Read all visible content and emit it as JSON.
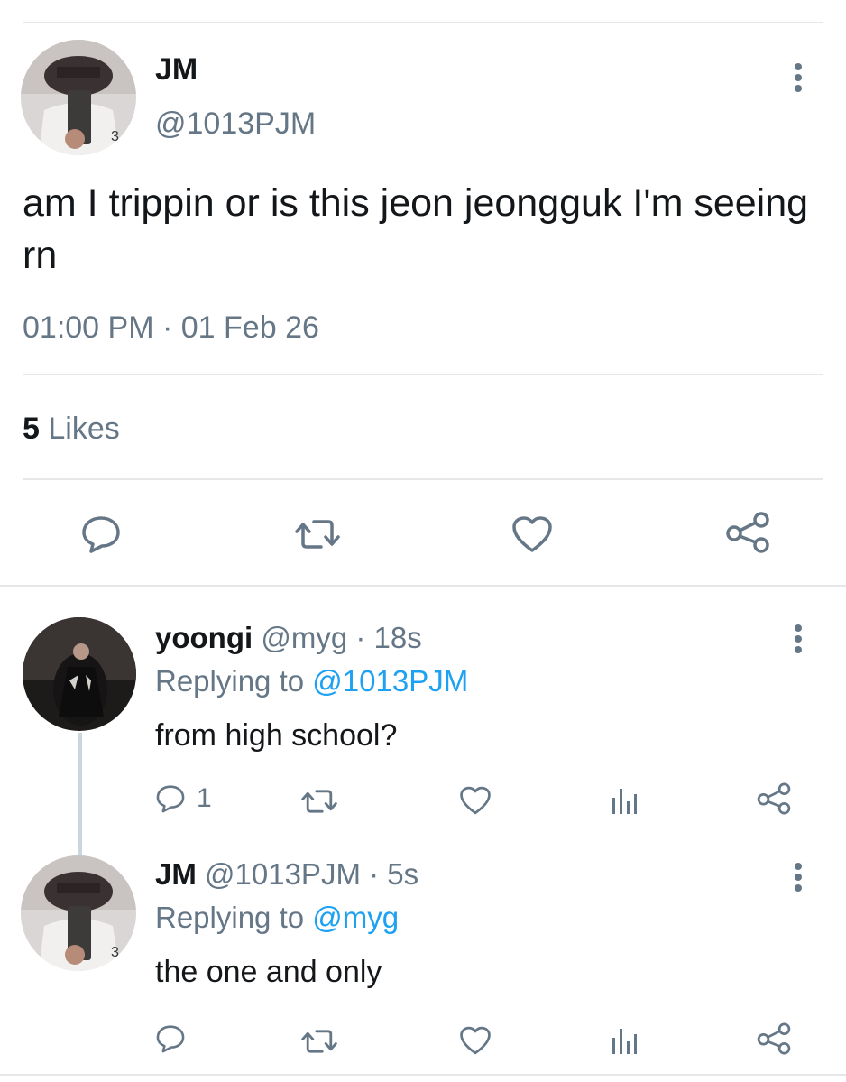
{
  "main_tweet": {
    "display_name": "JM",
    "handle": "@1013PJM",
    "text": "am I trippin or is this jeon jeongguk I'm seeing rn",
    "time": "01:00 PM",
    "date": "01 Feb 26",
    "likes_count": "5",
    "likes_label": "Likes"
  },
  "replies": [
    {
      "display_name": "yoongi",
      "handle": "@myg",
      "age": "18s",
      "replying_prefix": "Replying to",
      "replying_to": "@1013PJM",
      "text": "from high school?",
      "reply_count": "1"
    },
    {
      "display_name": "JM",
      "handle": "@1013PJM",
      "age": "5s",
      "replying_prefix": "Replying to",
      "replying_to": "@myg",
      "text": "the one and only",
      "reply_count": ""
    }
  ],
  "separator": "·",
  "icons": {
    "reply": "speech-bubble-icon",
    "retweet": "retweet-icon",
    "like": "heart-icon",
    "share": "share-icon",
    "analytics": "bar-chart-icon",
    "more": "vertical-dots-icon"
  },
  "colors": {
    "text": "#14171a",
    "secondary": "#657786",
    "link": "#1da1f2",
    "divider": "#e6e7e8"
  }
}
